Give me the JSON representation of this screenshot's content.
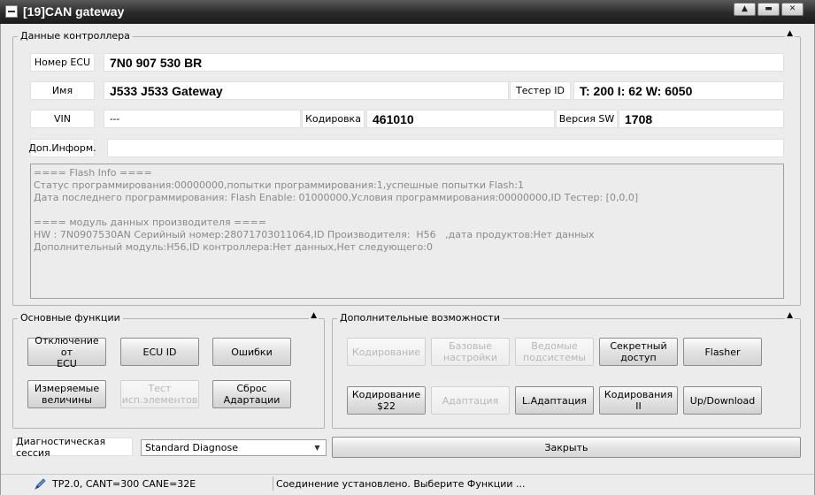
{
  "window": {
    "title": "[19]CAN gateway",
    "min_icon": "▲",
    "restore_icon": "▬",
    "close_icon": "✕"
  },
  "controller": {
    "legend": "Данные контроллера",
    "collapse_icon": "▲",
    "ecu_number_label": "Номер ECU",
    "ecu_number": "7N0 907 530 BR",
    "name_label": "Имя",
    "name": "J533 J533  Gateway",
    "tester_label": "Тестер ID",
    "tester": "T: 200 I: 62 W: 6050",
    "vin_label": "VIN",
    "vin": "---",
    "coding_label": "Кодировка",
    "coding": "461010",
    "sw_label": "Версия SW",
    "sw": "1708",
    "extra_label": "Доп.Информ.",
    "extra": "",
    "info_lines": [
      "==== Flash Info ====",
      "Статус программирования:00000000,попытки программирования:1,успешные попытки Flash:1",
      "Дата последнего программирования: Flash Enable: 01000000,Условия программирования:00000000,ID Тестер: [0,0,0]",
      "",
      "==== модуль данных производителя ====",
      "HW : 7N0907530AN Серийный номер:28071703011064,ID Производителя:  H56   ,дата продуктов:Нет данных",
      "Дополнительный модуль:H56,ID контроллера:Нет данных,Нет следующего:0"
    ]
  },
  "main_functions": {
    "legend": "Основные функции",
    "collapse_icon": "▲",
    "btn_disable": "Отключение от\nECU",
    "btn_ecu_id": "ECU ID",
    "btn_errors": "Ошибки",
    "btn_measured": "Измеряемые\nвеличины",
    "btn_test": "Тест\nисп.элементов",
    "btn_reset": "Сброс\nАдартации"
  },
  "extra_functions": {
    "legend": "Дополнительные возможности",
    "collapse_icon": "▲",
    "btn_coding": "Кодирование",
    "btn_basic": "Базовые\nнастройки",
    "btn_slaves": "Ведомые\nподсистемы",
    "btn_secret": "Секретный\nдоступ",
    "btn_flasher": "Flasher",
    "btn_coding22": "Кодирование\n$22",
    "btn_adaptation": "Адаптация",
    "btn_ladapt": "L.Адаптация",
    "btn_coding2": "Кодирования II",
    "btn_updown": "Up/Download"
  },
  "session": {
    "label": "Диагностическая сессия",
    "selected": "Standard Diagnose",
    "arrow_icon": "▼"
  },
  "close_label": "Закрыть",
  "status": {
    "protocol": "TP2.0, CANT=300 CANE=32E",
    "message": "Соединение установлено. Выберите Функции ..."
  }
}
